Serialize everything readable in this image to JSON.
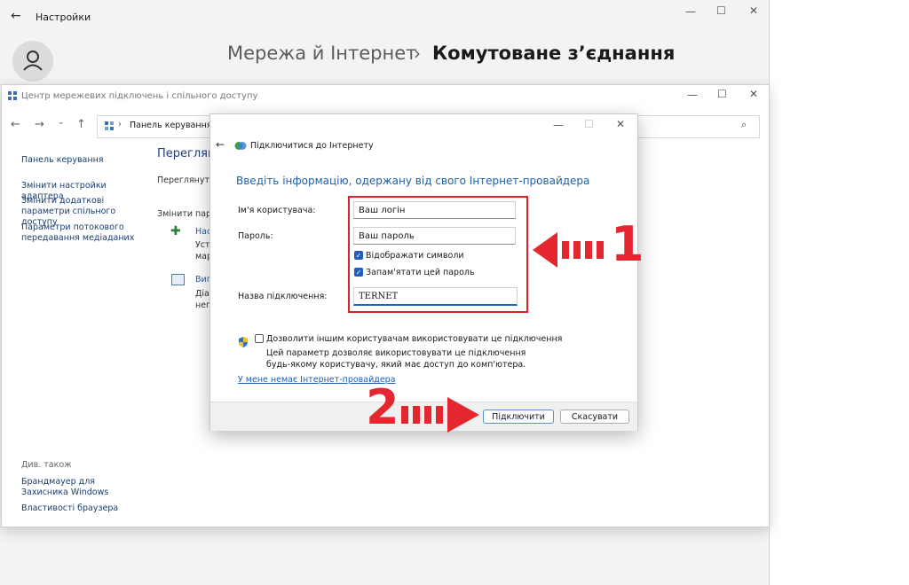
{
  "settings": {
    "title": "Настройки",
    "breadcrumb_parent": "Мережа й Інтернет",
    "breadcrumb_sep": "›",
    "breadcrumb_current": "Комутоване з’єднання"
  },
  "control_panel": {
    "title": "Центр мережевих підключень і спільного доступу",
    "address": "Панель керування",
    "sidebar": {
      "home": "Панель керування",
      "items": [
        "Змінити настройки адаптера",
        "Змінити додаткові параметри спільного доступу",
        "Параметри потокового передавання медіаданих"
      ],
      "see_also_label": "Див. також",
      "see_also": [
        "Брандмауер для Захисника Windows",
        "Властивості браузера"
      ]
    },
    "main": {
      "heading": "Переглянути",
      "sub1": "Переглянути",
      "sub2": "Змінити пара",
      "item1_title": "Нас",
      "item1_l1": "Уста",
      "item1_l2": "марі",
      "item2_title": "Вип",
      "item2_l1": "Діаг",
      "item2_l2": "непо"
    }
  },
  "dialog": {
    "title": "Підключитися до Інтернету",
    "heading": "Введіть інформацію, одержану від свого Інтернет-провайдера",
    "username_label": "Ім'я користувача:",
    "username_value": "Ваш логін",
    "password_label": "Пароль:",
    "password_value": "Ваш пароль",
    "show_chars": "Відображати символи",
    "remember_password": "Запам'ятати цей пароль",
    "connection_name_label": "Назва підключення:",
    "connection_name_value": "TERNET",
    "allow_others": "Дозволити іншим користувачам використовувати це підключення",
    "allow_note": "Цей параметр дозволяє використовувати це підключення будь-якому користувачу, який має доступ до комп'ютера.",
    "no_isp_link": "У мене немає Інтернет-провайдера",
    "connect_button": "Підключити",
    "cancel_button": "Скасувати"
  },
  "annotations": {
    "marker1": "1",
    "marker2": "2",
    "color": "#e3262f"
  }
}
